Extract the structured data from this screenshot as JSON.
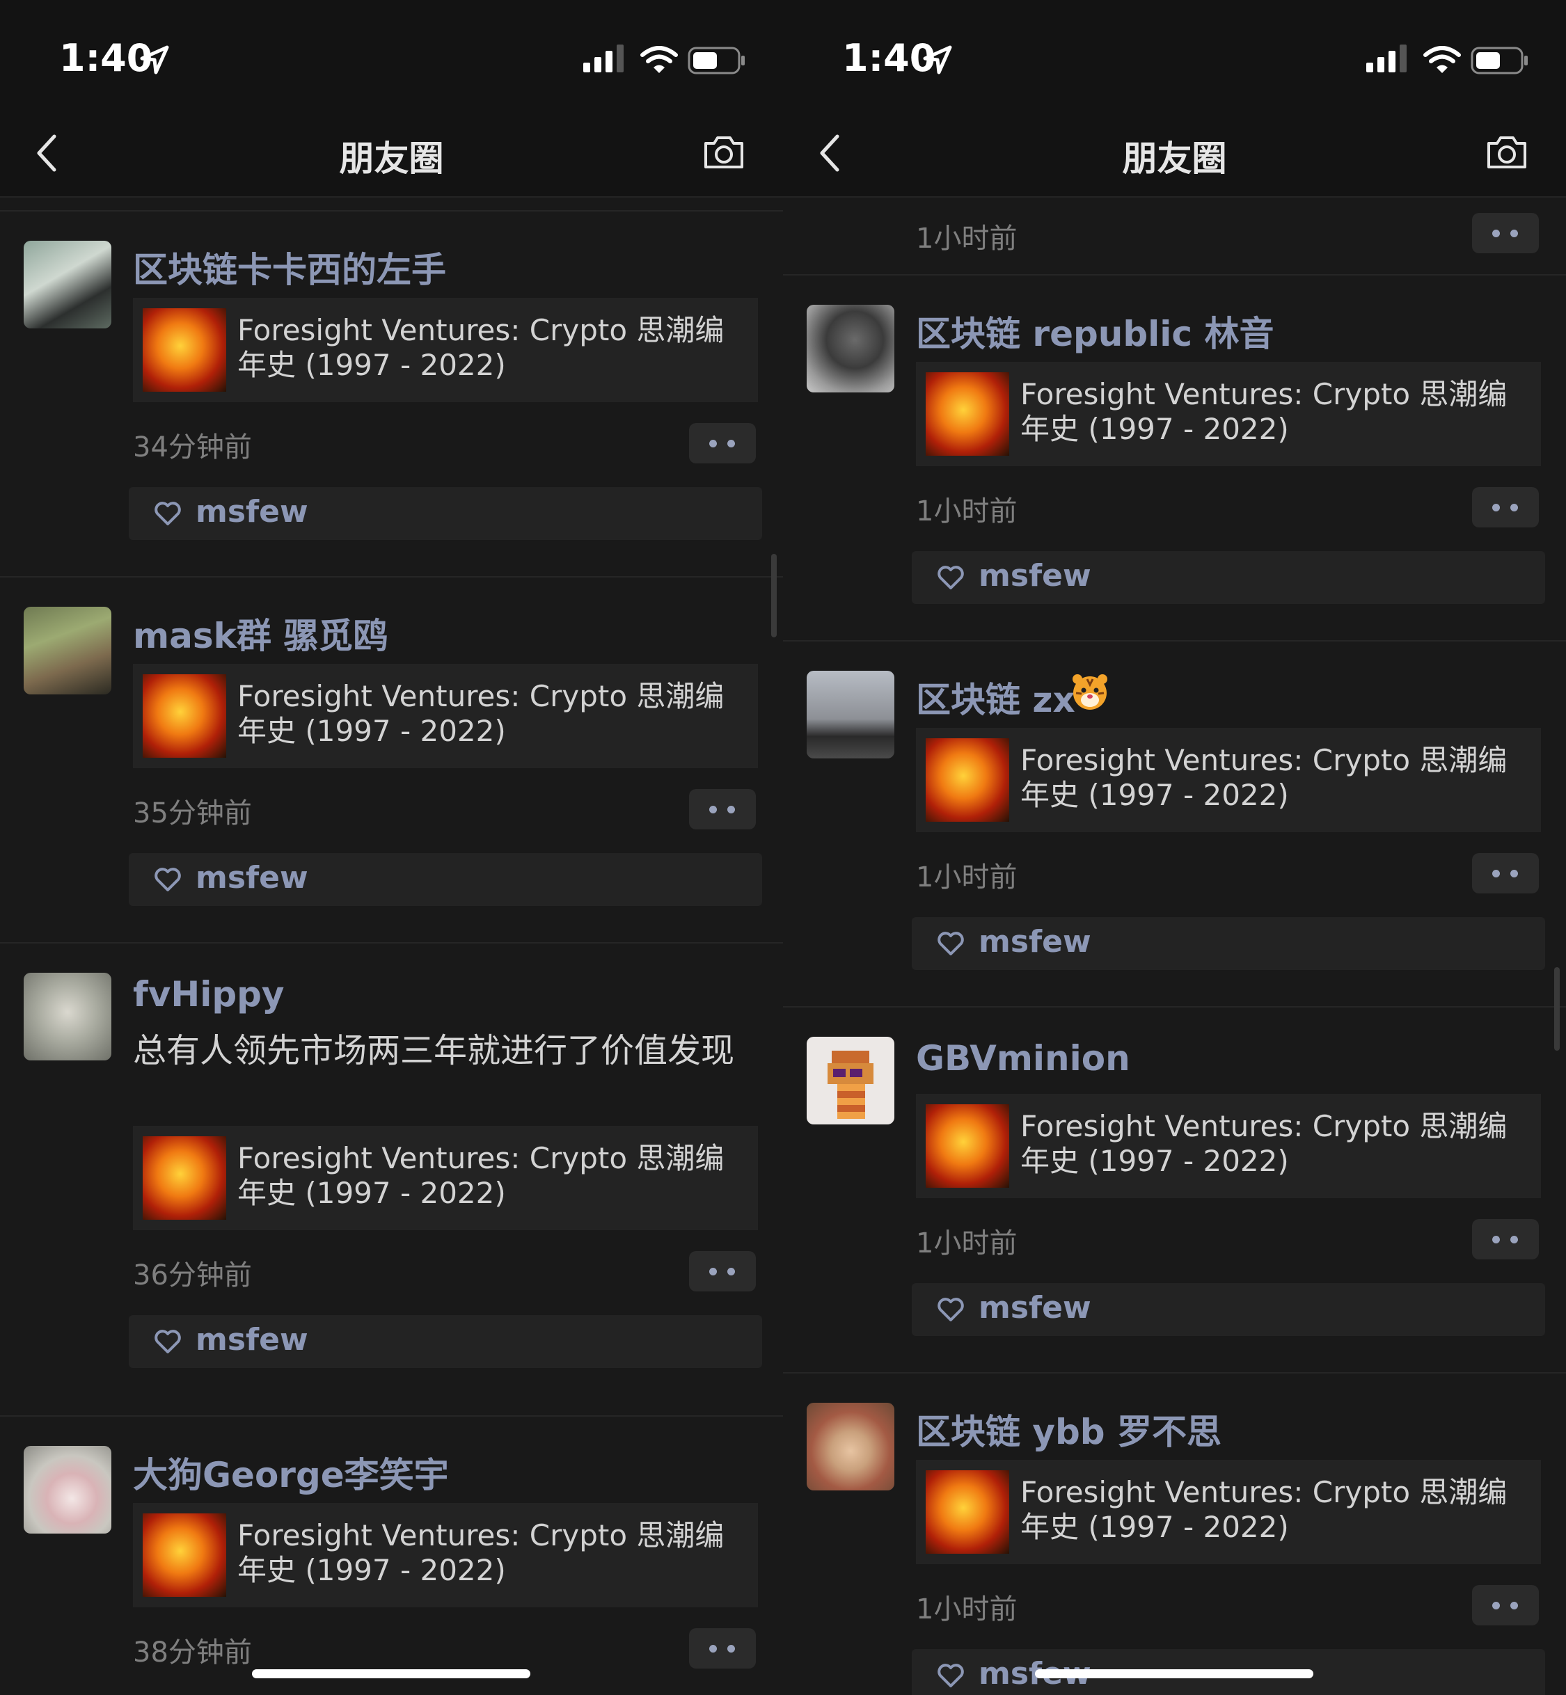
{
  "status": {
    "time": "1:40"
  },
  "nav": {
    "title": "朋友圈"
  },
  "left_posts": [
    {
      "name": "区块链卡卡西的左手",
      "link": "Foresight Ventures: Crypto 思潮编年史 (1997 - 2022)",
      "time": "34分钟前",
      "liker": "msfew"
    },
    {
      "name": "mask群 骡觅鸥",
      "link": "Foresight Ventures: Crypto 思潮编年史 (1997 - 2022)",
      "time": "35分钟前",
      "liker": "msfew"
    },
    {
      "name": "fvHippy",
      "caption": "总有人领先市场两三年就进行了价值发现",
      "link": "Foresight Ventures: Crypto 思潮编年史 (1997 - 2022)",
      "time": "36分钟前",
      "liker": "msfew"
    },
    {
      "name": "大狗George李笑宇",
      "link": "Foresight Ventures: Crypto 思潮编年史 (1997 - 2022)",
      "time": "38分钟前"
    }
  ],
  "right_top_time": "1小时前",
  "right_posts": [
    {
      "name": "区块链 republic 林音",
      "link": "Foresight Ventures: Crypto 思潮编年史 (1997 - 2022)",
      "time": "1小时前",
      "liker": "msfew"
    },
    {
      "name": "区块链 zx",
      "link": "Foresight Ventures: Crypto 思潮编年史 (1997 - 2022)",
      "time": "1小时前",
      "liker": "msfew"
    },
    {
      "name": "GBVminion",
      "link": "Foresight Ventures: Crypto 思潮编年史 (1997 - 2022)",
      "time": "1小时前",
      "liker": "msfew"
    },
    {
      "name": "区块链 ybb 罗不思",
      "link": "Foresight Ventures: Crypto 思潮编年史 (1997 - 2022)",
      "time": "1小时前",
      "liker": "msfew"
    }
  ],
  "colors": {
    "background": "#191919",
    "name": "#8c97b5",
    "card": "#232323",
    "timestamp": "#7f7f7f"
  },
  "icons": [
    "location-arrow-icon",
    "signal-icon",
    "wifi-icon",
    "battery-icon",
    "back-chevron-icon",
    "camera-icon",
    "heart-icon",
    "more-dots-icon",
    "tiger-emoji-icon"
  ]
}
